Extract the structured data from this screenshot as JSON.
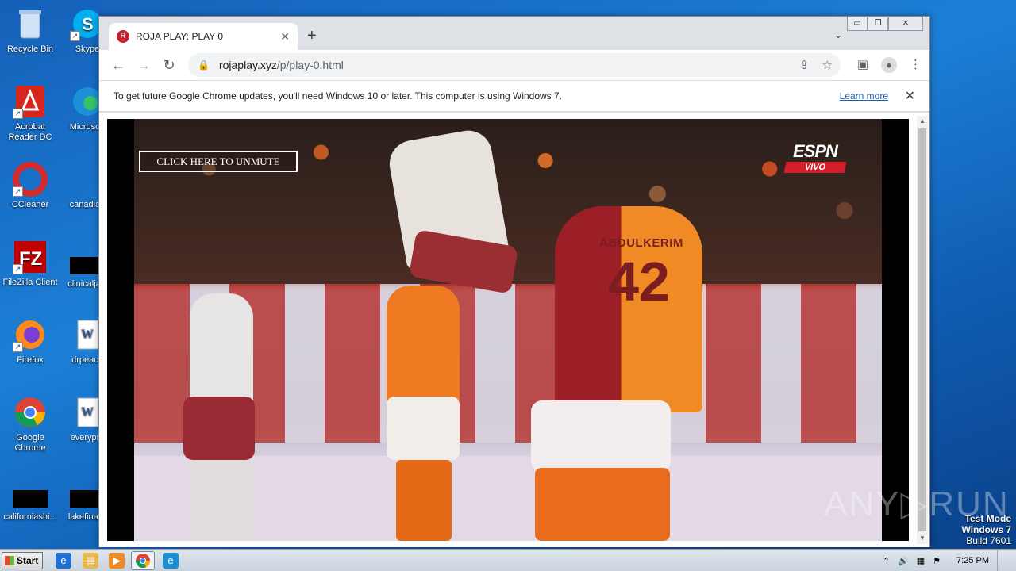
{
  "desktop": {
    "icons": [
      {
        "label": "Recycle Bin",
        "icon": "recycle-bin-icon"
      },
      {
        "label": "Skype",
        "icon": "skype-icon"
      },
      {
        "label": "Acrobat Reader DC",
        "icon": "acrobat-icon"
      },
      {
        "label": "Microsoft",
        "icon": "edge-icon"
      },
      {
        "label": "CCleaner",
        "icon": "ccleaner-icon"
      },
      {
        "label": "canadian",
        "icon": "file-icon"
      },
      {
        "label": "FileZilla Client",
        "icon": "filezilla-icon"
      },
      {
        "label": "clinicaljacl",
        "icon": "file-icon"
      },
      {
        "label": "Firefox",
        "icon": "firefox-icon"
      },
      {
        "label": "drpeace",
        "icon": "word-doc-icon"
      },
      {
        "label": "Google Chrome",
        "icon": "chrome-icon"
      },
      {
        "label": "everypre",
        "icon": "word-doc-icon"
      },
      {
        "label": "californiashi...",
        "icon": "file-icon"
      },
      {
        "label": "lakefinally",
        "icon": "file-icon"
      }
    ]
  },
  "browser": {
    "tab_title": "ROJA PLAY: PLAY 0",
    "tab_favicon_letter": "R",
    "url_host": "rojaplay.xyz",
    "url_path": "/p/play-0.html",
    "infobar_text": "To get future Google Chrome updates, you'll need Windows 10 or later. This computer is using Windows 7.",
    "infobar_link": "Learn more",
    "win_minimize": "▭",
    "win_restore": "❐",
    "win_close": "✕"
  },
  "video": {
    "unmute_label": "CLICK HERE TO UNMUTE",
    "broadcaster": "ESPN",
    "broadcaster_tag": "VIVO",
    "jersey_name": "ABDULKERIM",
    "jersey_number": "42"
  },
  "watermark": "ANY▷RUN",
  "system": {
    "test_mode": "Test Mode",
    "os_name": "Windows 7",
    "build": "Build 7601",
    "start_label": "Start",
    "clock": "7:25 PM"
  }
}
